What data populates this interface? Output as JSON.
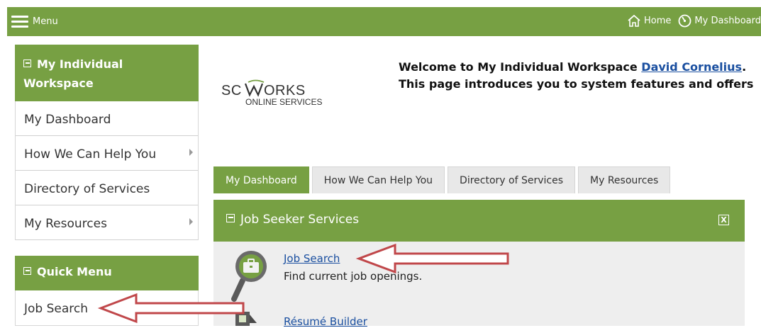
{
  "topbar": {
    "menu_label": "Menu",
    "home_label": "Home",
    "dashboard_label": "My Dashboard"
  },
  "sidebar": {
    "workspace_title": "My Individual Workspace",
    "items": [
      {
        "label": "My Dashboard"
      },
      {
        "label": "How We Can Help You"
      },
      {
        "label": "Directory of Services"
      },
      {
        "label": "My Resources"
      }
    ],
    "quick_menu_title": "Quick Menu",
    "quick_items": [
      {
        "label": "Job Search"
      }
    ]
  },
  "logo": {
    "line1": "SC WORKS",
    "line2": "ONLINE SERVICES"
  },
  "welcome": {
    "line1_prefix": "Welcome to My Individual Workspace ",
    "user_name": "David Cornelius",
    "line1_suffix": ".",
    "line2": "This page introduces you to system features and offers"
  },
  "tabs": [
    {
      "label": "My Dashboard"
    },
    {
      "label": "How We Can Help You"
    },
    {
      "label": "Directory of Services"
    },
    {
      "label": "My Resources"
    }
  ],
  "panel": {
    "title": "Job Seeker Services",
    "close_glyph": "X",
    "services": [
      {
        "title": "Job Search",
        "description": "Find current job openings."
      },
      {
        "title": "Résumé Builder"
      }
    ]
  },
  "colors": {
    "accent": "#77a043",
    "link": "#1a4fa0",
    "annotation_arrow": "#c0474a"
  }
}
